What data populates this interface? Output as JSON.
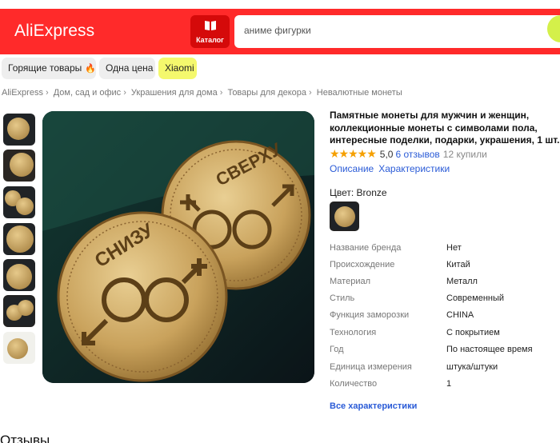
{
  "header": {
    "logo": "AliExpress",
    "catalog_label": "Каталог",
    "search_placeholder": "аниме фигурки"
  },
  "chips": [
    {
      "label": "Горящие товары"
    },
    {
      "label": "Одна цена"
    },
    {
      "label": "Xiaomi"
    }
  ],
  "breadcrumb": [
    "AliExpress",
    "Дом, сад и офис",
    "Украшения для дома",
    "Товары для декора",
    "Невалютные монеты"
  ],
  "product": {
    "title": "Памятные монеты для мужчин и женщин, коллекционные монеты с символами пола, интересные поделки, подарки, украшения, 1 шт.",
    "stars": "★★★★★",
    "rating": "5,0",
    "reviews_link": "6 отзывов",
    "sold": "12 купили",
    "tab_description": "Описание",
    "tab_specs": "Характеристики",
    "color_label": "Цвет: Bronze",
    "coin_text_left": "СНИЗУ",
    "coin_text_right": "СВЕРХУ"
  },
  "specs": [
    {
      "key": "Название бренда",
      "value": "Нет"
    },
    {
      "key": "Происхождение",
      "value": "Китай"
    },
    {
      "key": "Материал",
      "value": "Металл"
    },
    {
      "key": "Стиль",
      "value": "Современный"
    },
    {
      "key": "Функция заморозки",
      "value": "CHINA"
    },
    {
      "key": "Технология",
      "value": "С покрытием"
    },
    {
      "key": "Год",
      "value": "По настоящее время"
    },
    {
      "key": "Единица измерения",
      "value": "штука/штуки"
    },
    {
      "key": "Количество",
      "value": "1"
    }
  ],
  "more_specs_link": "Все характеристики",
  "reviews_section_title": "Отзывы",
  "colors": {
    "brand_red": "#ff2a2a",
    "link_blue": "#2a5bd7",
    "star_orange": "#f5a000",
    "xiaomi_chip": "#f4f86d"
  }
}
